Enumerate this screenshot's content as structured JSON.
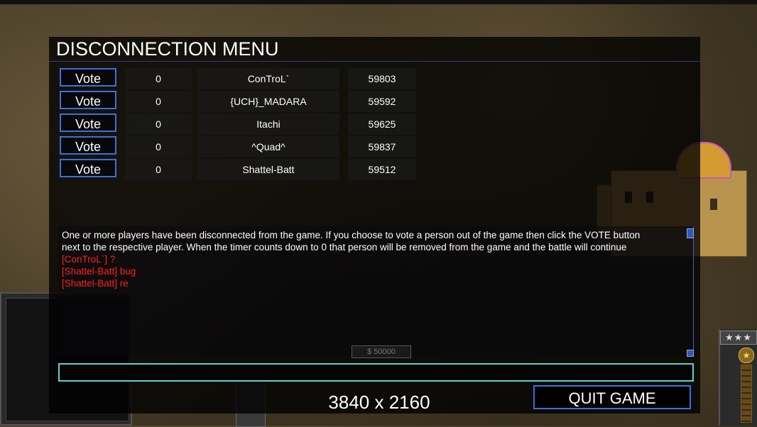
{
  "menu": {
    "title": "DISCONNECTION MENU",
    "players": [
      {
        "vote_label": "Vote",
        "votes": "0",
        "name": "ConTroL`",
        "ping": "59803"
      },
      {
        "vote_label": "Vote",
        "votes": "0",
        "name": "{UCH}_MADARA",
        "ping": "59592"
      },
      {
        "vote_label": "Vote",
        "votes": "0",
        "name": "Itachi",
        "ping": "59625"
      },
      {
        "vote_label": "Vote",
        "votes": "0",
        "name": "^Quad^",
        "ping": "59837"
      },
      {
        "vote_label": "Vote",
        "votes": "0",
        "name": "Shattel-Batt",
        "ping": "59512"
      }
    ],
    "chat": {
      "info_line_1": "One or more players have been disconnected from the game. If you choose to vote a person out of the game then click the VOTE button",
      "info_line_2": " next to the respective player. When the timer counts down to 0 that person will be removed from the game and the battle will continue",
      "messages": [
        "[ConTroL`] ?",
        "[Shattel-Batt] bug",
        "[Shattel-Batt] re"
      ],
      "message_color": "#ff2020"
    },
    "chat_input_value": "",
    "quit_label": "QUIT GAME",
    "resolution_label": "3840 x 2160"
  },
  "hud": {
    "money": "$ 50000",
    "rank_stars": "★★★",
    "medal_icon": "star-medal-icon"
  },
  "colors": {
    "button_border": "#3c6fd8",
    "input_border": "#62d0c8"
  }
}
